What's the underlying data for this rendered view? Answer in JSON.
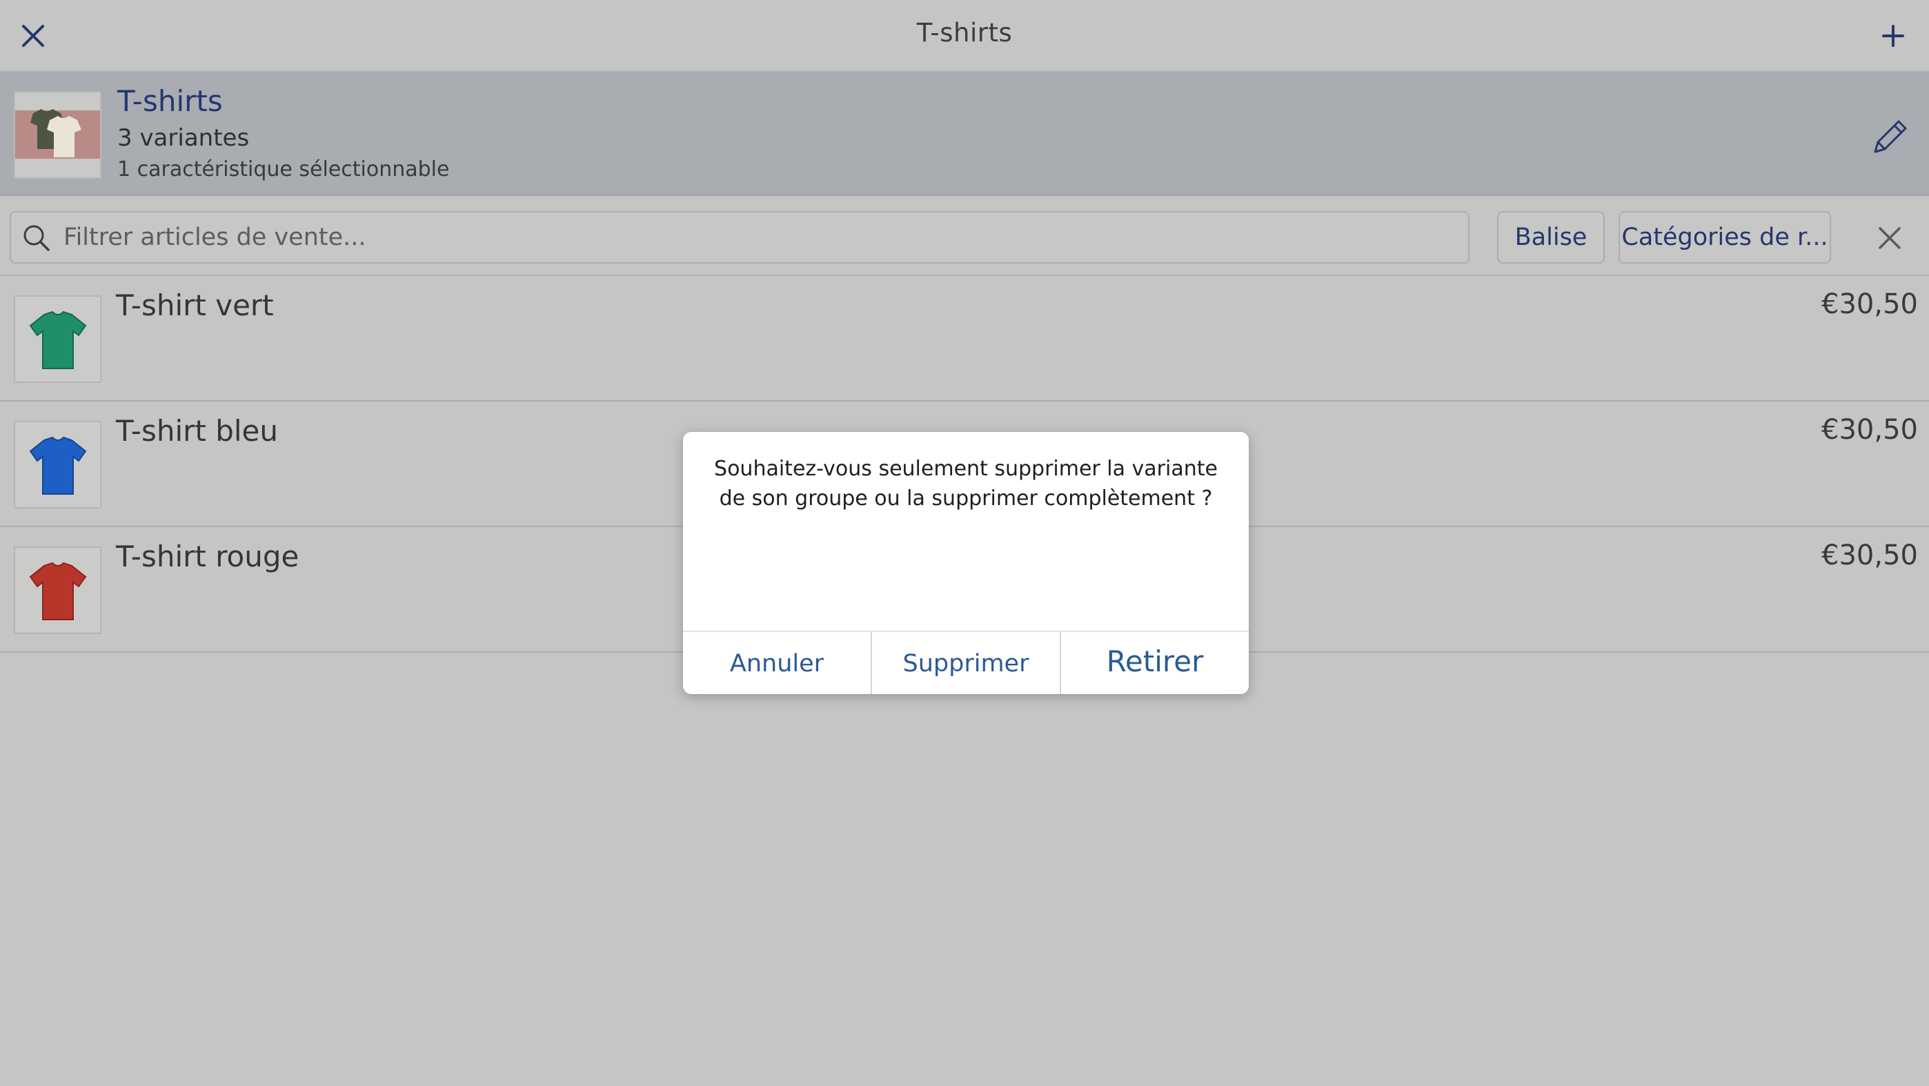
{
  "navbar": {
    "title": "T-shirts",
    "close_icon": "close-icon",
    "add_icon": "plus-icon"
  },
  "group": {
    "name": "T-shirts",
    "variants": "3 variantes",
    "features": "1 caractéristique sélectionnable",
    "edit_icon": "pencil-icon"
  },
  "filter": {
    "placeholder": "Filtrer articles de vente...",
    "value": "",
    "tag_label": "Balise",
    "category_label": "Catégories de r...",
    "clear_icon": "close-icon"
  },
  "items": [
    {
      "name": "T-shirt vert",
      "price": "€30,50",
      "color": "#1f8f6a"
    },
    {
      "name": "T-shirt bleu",
      "price": "€30,50",
      "color": "#1d5fc4"
    },
    {
      "name": "T-shirt rouge",
      "price": "€30,50",
      "color": "#b8352c"
    }
  ],
  "dialog": {
    "message": "Souhaitez-vous seulement supprimer la variante de son groupe ou la supprimer complètement ?",
    "cancel_label": "Annuler",
    "delete_label": "Supprimer",
    "remove_label": "Retirer"
  },
  "colors": {
    "accent": "#24376e",
    "link": "#2b5a93",
    "background": "#c5c5c3",
    "header_band": "#a9acb0"
  }
}
